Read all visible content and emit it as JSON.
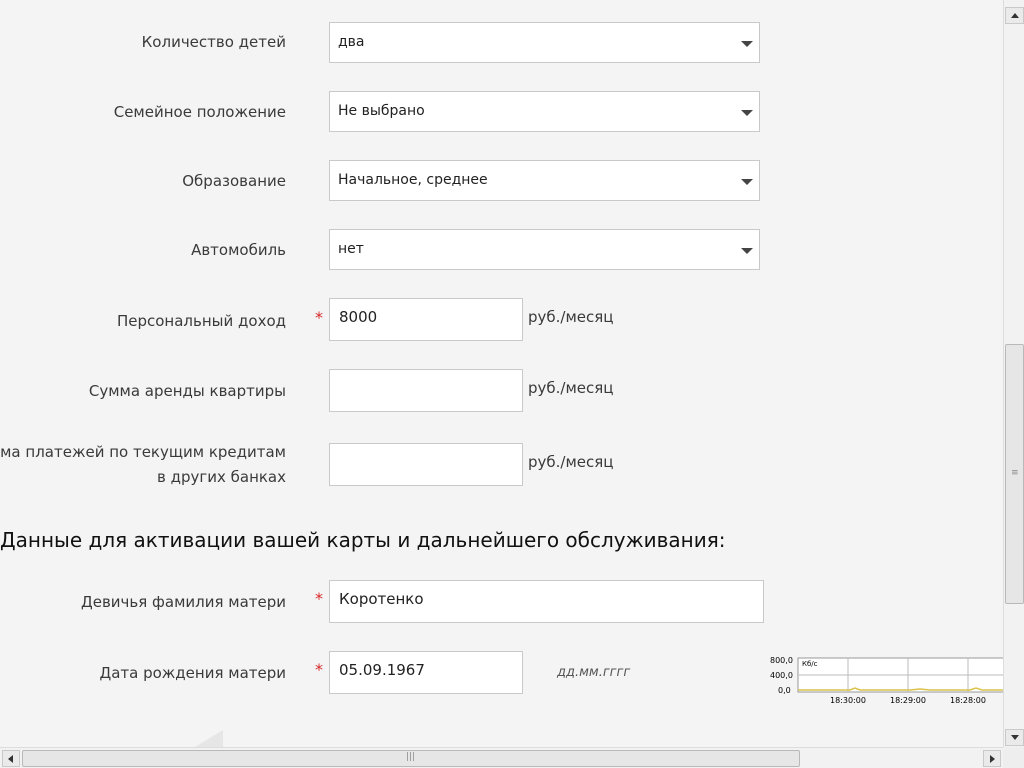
{
  "form": {
    "rows": [
      {
        "label": "Количество детей",
        "value": "два"
      },
      {
        "label": "Семейное положение",
        "value": "Не выбрано"
      },
      {
        "label": "Образование",
        "value": "Начальное, среднее"
      },
      {
        "label": "Автомобиль",
        "value": "нет"
      }
    ],
    "income": {
      "label": "Персональный доход",
      "required": "*",
      "value": "8000",
      "unit": "руб./месяц"
    },
    "rent": {
      "label": "Сумма аренды квартиры",
      "value": "",
      "unit": "руб./месяц"
    },
    "credits": {
      "label_line1": "Сумма платежей по текущим кредитам",
      "label_line2": "в других банках",
      "value": "",
      "unit": "руб./месяц"
    },
    "section_title": "Данные для активации вашей карты и дальнейшего обслуживания:",
    "maiden_name": {
      "label": "Девичья фамилия матери",
      "required": "*",
      "value": "Коротенко"
    },
    "mother_dob": {
      "label": "Дата рождения матери",
      "required": "*",
      "value": "05.09.1967",
      "hint": "дд.мм.гггг"
    }
  },
  "network_graph": {
    "y_ticks": [
      "800,0",
      "400,0",
      "0,0"
    ],
    "unit": "Кб/с",
    "x_ticks": [
      "18:30:00",
      "18:29:00",
      "18:28:00"
    ],
    "line_color": "#d9c24a"
  },
  "scrollbars": {
    "vertical_grip": "≡",
    "horizontal_grip": "|||"
  }
}
